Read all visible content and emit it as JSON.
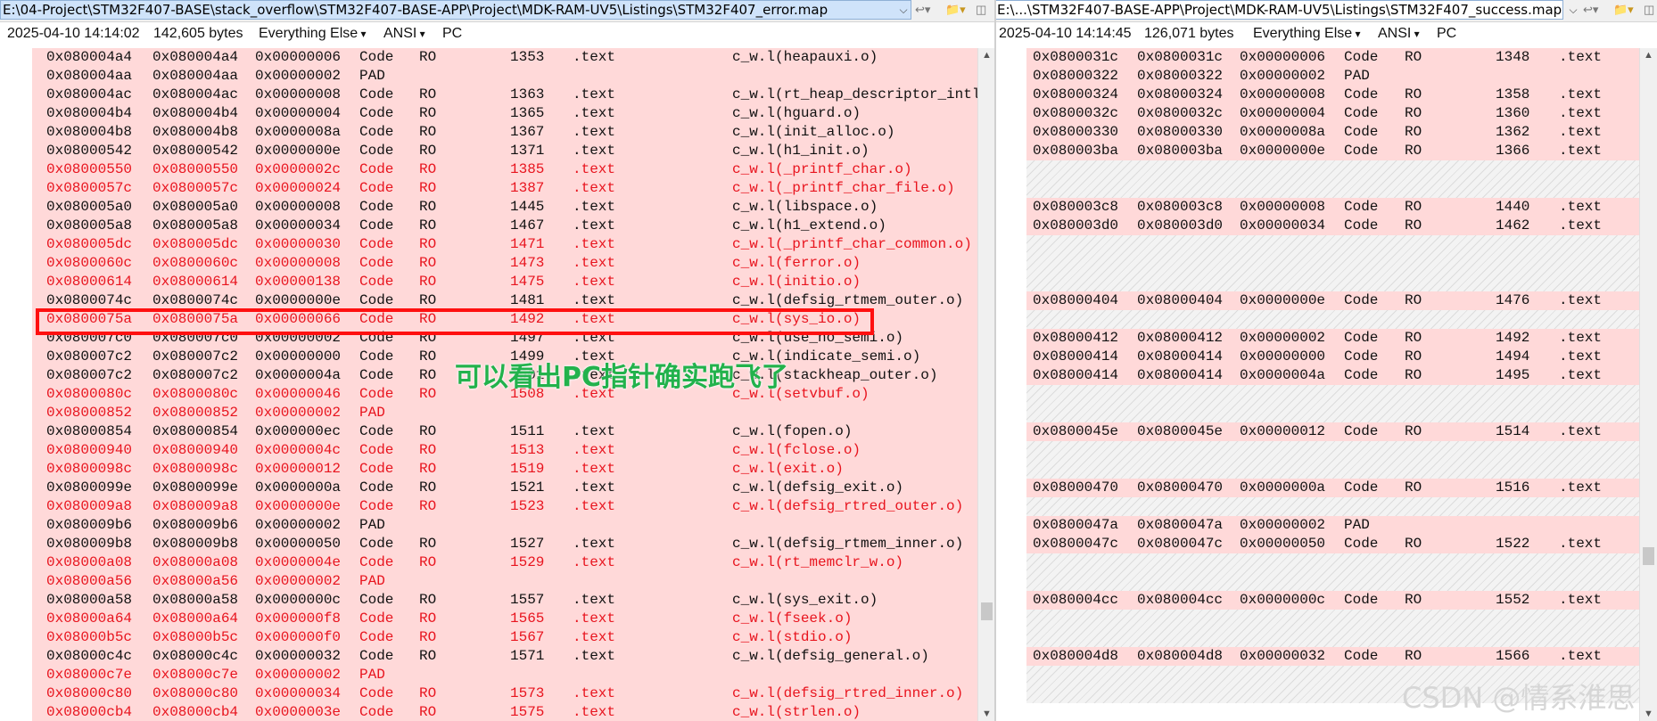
{
  "left": {
    "path": "E:\\04-Project\\STM32F407-BASE\\stack_overflow\\STM32F407-BASE-APP\\Project\\MDK-RAM-UV5\\Listings\\STM32F407_error.map",
    "timestamp": "2025-04-10 14:14:02",
    "size": "142,605 bytes",
    "filter": "Everything Else",
    "encoding": "ANSI",
    "lineend": "PC",
    "rows": [
      {
        "a": "0x080004a4",
        "b": "0x080004a4",
        "sz": "0x00000006",
        "t": "Code",
        "r": "RO",
        "n": "1353",
        "s": ".text",
        "o": "c_w.l(heapauxi.o)",
        "red": false
      },
      {
        "a": "0x080004aa",
        "b": "0x080004aa",
        "sz": "0x00000002",
        "t": "PAD",
        "r": "",
        "n": "",
        "s": "",
        "o": "",
        "red": false
      },
      {
        "a": "0x080004ac",
        "b": "0x080004ac",
        "sz": "0x00000008",
        "t": "Code",
        "r": "RO",
        "n": "1363",
        "s": ".text",
        "o": "c_w.l(rt_heap_descriptor_intli",
        "red": false
      },
      {
        "a": "0x080004b4",
        "b": "0x080004b4",
        "sz": "0x00000004",
        "t": "Code",
        "r": "RO",
        "n": "1365",
        "s": ".text",
        "o": "c_w.l(hguard.o)",
        "red": false
      },
      {
        "a": "0x080004b8",
        "b": "0x080004b8",
        "sz": "0x0000008a",
        "t": "Code",
        "r": "RO",
        "n": "1367",
        "s": ".text",
        "o": "c_w.l(init_alloc.o)",
        "red": false
      },
      {
        "a": "0x08000542",
        "b": "0x08000542",
        "sz": "0x0000000e",
        "t": "Code",
        "r": "RO",
        "n": "1371",
        "s": ".text",
        "o": "c_w.l(h1_init.o)",
        "red": false
      },
      {
        "a": "0x08000550",
        "b": "0x08000550",
        "sz": "0x0000002c",
        "t": "Code",
        "r": "RO",
        "n": "1385",
        "s": ".text",
        "o": "c_w.l(_printf_char.o)",
        "red": true
      },
      {
        "a": "0x0800057c",
        "b": "0x0800057c",
        "sz": "0x00000024",
        "t": "Code",
        "r": "RO",
        "n": "1387",
        "s": ".text",
        "o": "c_w.l(_printf_char_file.o)",
        "red": true
      },
      {
        "a": "0x080005a0",
        "b": "0x080005a0",
        "sz": "0x00000008",
        "t": "Code",
        "r": "RO",
        "n": "1445",
        "s": ".text",
        "o": "c_w.l(libspace.o)",
        "red": false
      },
      {
        "a": "0x080005a8",
        "b": "0x080005a8",
        "sz": "0x00000034",
        "t": "Code",
        "r": "RO",
        "n": "1467",
        "s": ".text",
        "o": "c_w.l(h1_extend.o)",
        "red": false
      },
      {
        "a": "0x080005dc",
        "b": "0x080005dc",
        "sz": "0x00000030",
        "t": "Code",
        "r": "RO",
        "n": "1471",
        "s": ".text",
        "o": "c_w.l(_printf_char_common.o)",
        "red": true
      },
      {
        "a": "0x0800060c",
        "b": "0x0800060c",
        "sz": "0x00000008",
        "t": "Code",
        "r": "RO",
        "n": "1473",
        "s": ".text",
        "o": "c_w.l(ferror.o)",
        "red": true
      },
      {
        "a": "0x08000614",
        "b": "0x08000614",
        "sz": "0x00000138",
        "t": "Code",
        "r": "RO",
        "n": "1475",
        "s": ".text",
        "o": "c_w.l(initio.o)",
        "red": true
      },
      {
        "a": "0x0800074c",
        "b": "0x0800074c",
        "sz": "0x0000000e",
        "t": "Code",
        "r": "RO",
        "n": "1481",
        "s": ".text",
        "o": "c_w.l(defsig_rtmem_outer.o)",
        "red": false
      },
      {
        "a": "0x0800075a",
        "b": "0x0800075a",
        "sz": "0x00000066",
        "t": "Code",
        "r": "RO",
        "n": "1492",
        "s": ".text",
        "o": "c_w.l(sys_io.o)",
        "red": true,
        "sel": true
      },
      {
        "a": "0x080007c0",
        "b": "0x080007c0",
        "sz": "0x00000002",
        "t": "Code",
        "r": "RO",
        "n": "1497",
        "s": ".text",
        "o": "c_w.l(use_no_semi.o)",
        "red": false
      },
      {
        "a": "0x080007c2",
        "b": "0x080007c2",
        "sz": "0x00000000",
        "t": "Code",
        "r": "RO",
        "n": "1499",
        "s": ".text",
        "o": "c_w.l(indicate_semi.o)",
        "red": false
      },
      {
        "a": "0x080007c2",
        "b": "0x080007c2",
        "sz": "0x0000004a",
        "t": "Code",
        "r": "RO",
        "n": "1501",
        "s": ".text",
        "o": "c_w.l(stackheap_outer.o)",
        "red": false
      },
      {
        "a": "0x0800080c",
        "b": "0x0800080c",
        "sz": "0x00000046",
        "t": "Code",
        "r": "RO",
        "n": "1508",
        "s": ".text",
        "o": "c_w.l(setvbuf.o)",
        "red": true
      },
      {
        "a": "0x08000852",
        "b": "0x08000852",
        "sz": "0x00000002",
        "t": "PAD",
        "r": "",
        "n": "",
        "s": "",
        "o": "",
        "red": true
      },
      {
        "a": "0x08000854",
        "b": "0x08000854",
        "sz": "0x000000ec",
        "t": "Code",
        "r": "RO",
        "n": "1511",
        "s": ".text",
        "o": "c_w.l(fopen.o)",
        "red": false
      },
      {
        "a": "0x08000940",
        "b": "0x08000940",
        "sz": "0x0000004c",
        "t": "Code",
        "r": "RO",
        "n": "1513",
        "s": ".text",
        "o": "c_w.l(fclose.o)",
        "red": true
      },
      {
        "a": "0x0800098c",
        "b": "0x0800098c",
        "sz": "0x00000012",
        "t": "Code",
        "r": "RO",
        "n": "1519",
        "s": ".text",
        "o": "c_w.l(exit.o)",
        "red": true
      },
      {
        "a": "0x0800099e",
        "b": "0x0800099e",
        "sz": "0x0000000a",
        "t": "Code",
        "r": "RO",
        "n": "1521",
        "s": ".text",
        "o": "c_w.l(defsig_exit.o)",
        "red": false
      },
      {
        "a": "0x080009a8",
        "b": "0x080009a8",
        "sz": "0x0000000e",
        "t": "Code",
        "r": "RO",
        "n": "1523",
        "s": ".text",
        "o": "c_w.l(defsig_rtred_outer.o)",
        "red": true
      },
      {
        "a": "0x080009b6",
        "b": "0x080009b6",
        "sz": "0x00000002",
        "t": "PAD",
        "r": "",
        "n": "",
        "s": "",
        "o": "",
        "red": false
      },
      {
        "a": "0x080009b8",
        "b": "0x080009b8",
        "sz": "0x00000050",
        "t": "Code",
        "r": "RO",
        "n": "1527",
        "s": ".text",
        "o": "c_w.l(defsig_rtmem_inner.o)",
        "red": false
      },
      {
        "a": "0x08000a08",
        "b": "0x08000a08",
        "sz": "0x0000004e",
        "t": "Code",
        "r": "RO",
        "n": "1529",
        "s": ".text",
        "o": "c_w.l(rt_memclr_w.o)",
        "red": true
      },
      {
        "a": "0x08000a56",
        "b": "0x08000a56",
        "sz": "0x00000002",
        "t": "PAD",
        "r": "",
        "n": "",
        "s": "",
        "o": "",
        "red": true
      },
      {
        "a": "0x08000a58",
        "b": "0x08000a58",
        "sz": "0x0000000c",
        "t": "Code",
        "r": "RO",
        "n": "1557",
        "s": ".text",
        "o": "c_w.l(sys_exit.o)",
        "red": false
      },
      {
        "a": "0x08000a64",
        "b": "0x08000a64",
        "sz": "0x000000f8",
        "t": "Code",
        "r": "RO",
        "n": "1565",
        "s": ".text",
        "o": "c_w.l(fseek.o)",
        "red": true
      },
      {
        "a": "0x08000b5c",
        "b": "0x08000b5c",
        "sz": "0x000000f0",
        "t": "Code",
        "r": "RO",
        "n": "1567",
        "s": ".text",
        "o": "c_w.l(stdio.o)",
        "red": true
      },
      {
        "a": "0x08000c4c",
        "b": "0x08000c4c",
        "sz": "0x00000032",
        "t": "Code",
        "r": "RO",
        "n": "1571",
        "s": ".text",
        "o": "c_w.l(defsig_general.o)",
        "red": false
      },
      {
        "a": "0x08000c7e",
        "b": "0x08000c7e",
        "sz": "0x00000002",
        "t": "PAD",
        "r": "",
        "n": "",
        "s": "",
        "o": "",
        "red": true
      },
      {
        "a": "0x08000c80",
        "b": "0x08000c80",
        "sz": "0x00000034",
        "t": "Code",
        "r": "RO",
        "n": "1573",
        "s": ".text",
        "o": "c_w.l(defsig_rtred_inner.o)",
        "red": true
      },
      {
        "a": "0x08000cb4",
        "b": "0x08000cb4",
        "sz": "0x0000003e",
        "t": "Code",
        "r": "RO",
        "n": "1575",
        "s": ".text",
        "o": "c_w.l(strlen.o)",
        "red": true
      }
    ]
  },
  "right": {
    "path": "E:\\...\\STM32F407-BASE-APP\\Project\\MDK-RAM-UV5\\Listings\\STM32F407_success.map",
    "timestamp": "2025-04-10 14:14:45",
    "size": "126,071 bytes",
    "filter": "Everything Else",
    "encoding": "ANSI",
    "lineend": "PC",
    "rows": [
      {
        "a": "0x0800031c",
        "b": "0x0800031c",
        "sz": "0x00000006",
        "t": "Code",
        "r": "RO",
        "n": "1348",
        "s": ".text"
      },
      {
        "a": "0x08000322",
        "b": "0x08000322",
        "sz": "0x00000002",
        "t": "PAD",
        "r": "",
        "n": "",
        "s": ""
      },
      {
        "a": "0x08000324",
        "b": "0x08000324",
        "sz": "0x00000008",
        "t": "Code",
        "r": "RO",
        "n": "1358",
        "s": ".text"
      },
      {
        "a": "0x0800032c",
        "b": "0x0800032c",
        "sz": "0x00000004",
        "t": "Code",
        "r": "RO",
        "n": "1360",
        "s": ".text"
      },
      {
        "a": "0x08000330",
        "b": "0x08000330",
        "sz": "0x0000008a",
        "t": "Code",
        "r": "RO",
        "n": "1362",
        "s": ".text"
      },
      {
        "a": "0x080003ba",
        "b": "0x080003ba",
        "sz": "0x0000000e",
        "t": "Code",
        "r": "RO",
        "n": "1366",
        "s": ".text"
      },
      {
        "blank": 2
      },
      {
        "a": "0x080003c8",
        "b": "0x080003c8",
        "sz": "0x00000008",
        "t": "Code",
        "r": "RO",
        "n": "1440",
        "s": ".text"
      },
      {
        "a": "0x080003d0",
        "b": "0x080003d0",
        "sz": "0x00000034",
        "t": "Code",
        "r": "RO",
        "n": "1462",
        "s": ".text"
      },
      {
        "blank": 3
      },
      {
        "a": "0x08000404",
        "b": "0x08000404",
        "sz": "0x0000000e",
        "t": "Code",
        "r": "RO",
        "n": "1476",
        "s": ".text"
      },
      {
        "blank": 1
      },
      {
        "a": "0x08000412",
        "b": "0x08000412",
        "sz": "0x00000002",
        "t": "Code",
        "r": "RO",
        "n": "1492",
        "s": ".text"
      },
      {
        "a": "0x08000414",
        "b": "0x08000414",
        "sz": "0x00000000",
        "t": "Code",
        "r": "RO",
        "n": "1494",
        "s": ".text"
      },
      {
        "a": "0x08000414",
        "b": "0x08000414",
        "sz": "0x0000004a",
        "t": "Code",
        "r": "RO",
        "n": "1495",
        "s": ".text"
      },
      {
        "blank": 2
      },
      {
        "a": "0x0800045e",
        "b": "0x0800045e",
        "sz": "0x00000012",
        "t": "Code",
        "r": "RO",
        "n": "1514",
        "s": ".text"
      },
      {
        "blank": 2
      },
      {
        "a": "0x08000470",
        "b": "0x08000470",
        "sz": "0x0000000a",
        "t": "Code",
        "r": "RO",
        "n": "1516",
        "s": ".text"
      },
      {
        "blank": 1
      },
      {
        "a": "0x0800047a",
        "b": "0x0800047a",
        "sz": "0x00000002",
        "t": "PAD",
        "r": "",
        "n": "",
        "s": ""
      },
      {
        "a": "0x0800047c",
        "b": "0x0800047c",
        "sz": "0x00000050",
        "t": "Code",
        "r": "RO",
        "n": "1522",
        "s": ".text"
      },
      {
        "blank": 2
      },
      {
        "a": "0x080004cc",
        "b": "0x080004cc",
        "sz": "0x0000000c",
        "t": "Code",
        "r": "RO",
        "n": "1552",
        "s": ".text"
      },
      {
        "blank": 2
      },
      {
        "a": "0x080004d8",
        "b": "0x080004d8",
        "sz": "0x00000032",
        "t": "Code",
        "r": "RO",
        "n": "1566",
        "s": ".text"
      },
      {
        "blank": 2
      }
    ]
  },
  "annotation": "可以看出PC指针确实跑飞了",
  "watermark": "CSDN @情系淮思",
  "colors": {
    "diff_bg": "#ffd9d9",
    "diff_text": "#e8141e",
    "selection": "#a8c8ee",
    "highlight_box": "#ff1010",
    "annotation_text": "#22b24c"
  }
}
